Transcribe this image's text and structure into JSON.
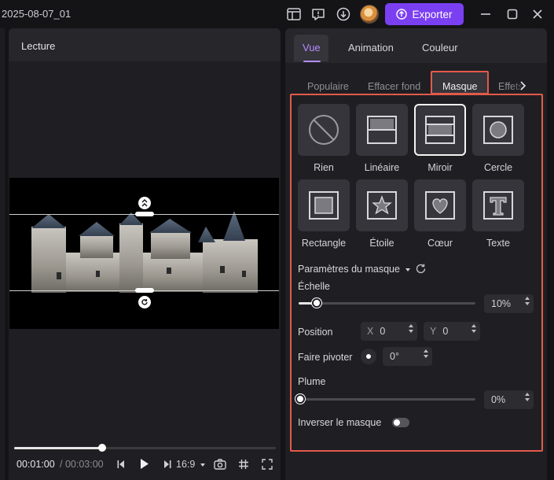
{
  "app": {
    "project_title": "2025-08-07_01",
    "export_label": "Exporter",
    "accent_color": "#7b3ff2",
    "highlight_color": "#e35a4a"
  },
  "preview": {
    "title": "Lecture",
    "time_current": "00:01:00",
    "time_separator": "/",
    "time_total": "00:03:00",
    "progress": 0.333,
    "aspect_ratio": "16:9"
  },
  "tabs": [
    {
      "label": "Vue",
      "active": true
    },
    {
      "label": "Animation",
      "active": false
    },
    {
      "label": "Couleur",
      "active": false
    }
  ],
  "subtabs": [
    {
      "label": "Populaire",
      "active": false
    },
    {
      "label": "Effacer fond",
      "active": false
    },
    {
      "label": "Masque",
      "active": true
    },
    {
      "label": "Effets",
      "active": false
    }
  ],
  "masks": [
    {
      "label": "Rien",
      "icon": "none-icon",
      "selected": false
    },
    {
      "label": "Linéaire",
      "icon": "linear-mask-icon",
      "selected": false
    },
    {
      "label": "Miroir",
      "icon": "mirror-mask-icon",
      "selected": true
    },
    {
      "label": "Cercle",
      "icon": "circle-mask-icon",
      "selected": false
    },
    {
      "label": "Rectangle",
      "icon": "rectangle-mask-icon",
      "selected": false
    },
    {
      "label": "Étoile",
      "icon": "star-mask-icon",
      "selected": false
    },
    {
      "label": "Cœur",
      "icon": "heart-mask-icon",
      "selected": false
    },
    {
      "label": "Texte",
      "icon": "text-mask-icon",
      "selected": false
    }
  ],
  "params": {
    "section_title": "Paramètres du masque",
    "scale_label": "Échelle",
    "scale_value": "10%",
    "scale_fraction": 0.1,
    "position_label": "Position",
    "x_label": "X",
    "x_value": "0",
    "y_label": "Y",
    "y_value": "0",
    "rotate_label": "Faire pivoter",
    "rotate_value": "0°",
    "feather_label": "Plume",
    "feather_value": "0%",
    "feather_fraction": 0,
    "invert_label": "Inverser le masque",
    "invert_on": false
  }
}
